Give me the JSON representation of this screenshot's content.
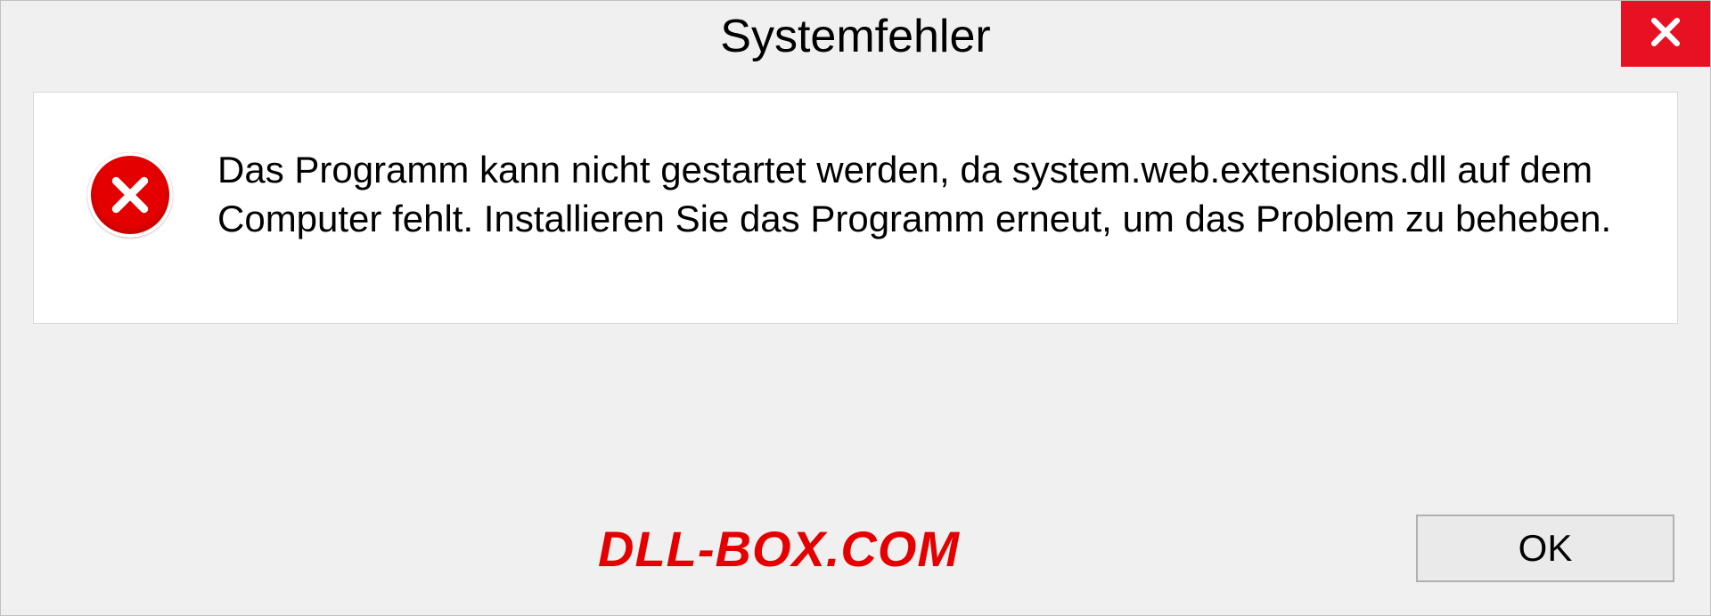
{
  "dialog": {
    "title": "Systemfehler",
    "message": "Das Programm kann nicht gestartet werden, da system.web.extensions.dll auf dem Computer fehlt. Installieren Sie das Programm erneut, um das Problem zu beheben.",
    "ok_label": "OK"
  },
  "watermark": "DLL-BOX.COM"
}
